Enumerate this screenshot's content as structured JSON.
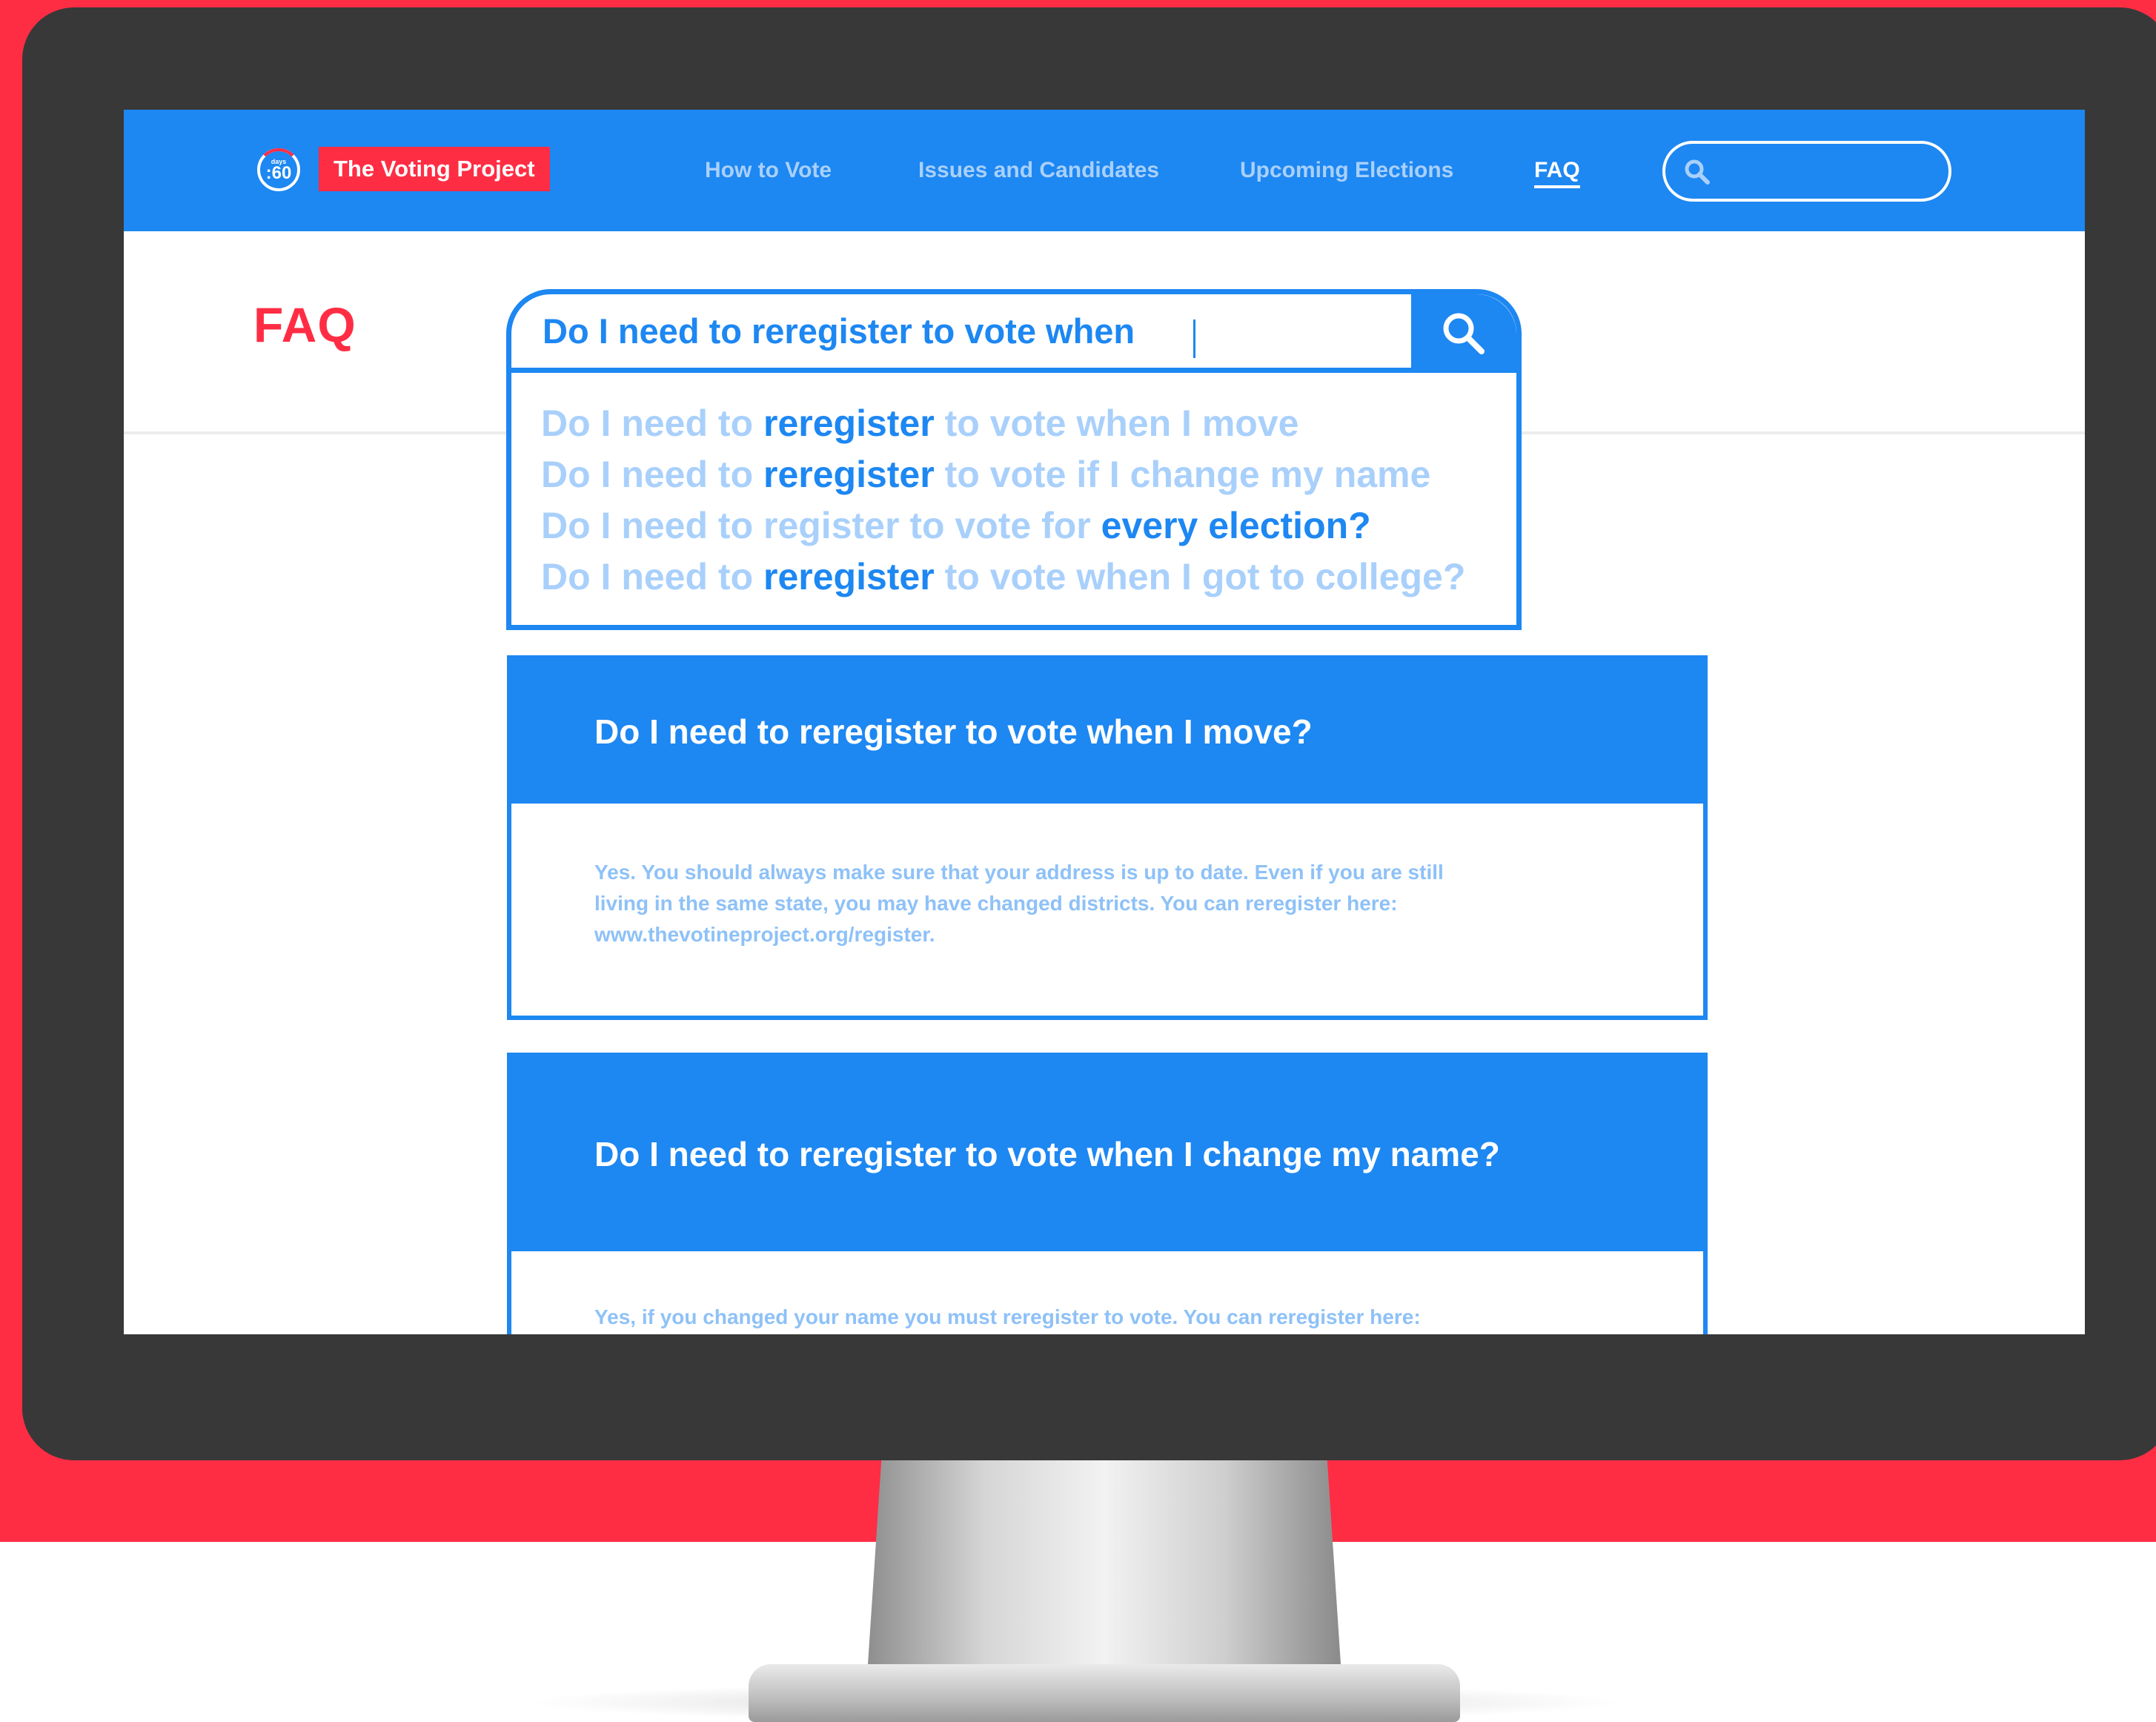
{
  "header": {
    "logo": {
      "small_text": "days",
      "big_text": ":60"
    },
    "brand": "The Voting Project",
    "nav": [
      {
        "label": "How to Vote"
      },
      {
        "label": "Issues and Candidates"
      },
      {
        "label": "Upcoming Elections"
      },
      {
        "label": "FAQ",
        "active": true
      }
    ],
    "search_placeholder": ""
  },
  "page": {
    "title": "FAQ"
  },
  "faq_search": {
    "query": "Do I need to reregister to vote when",
    "suggestions": [
      [
        {
          "t": "Do I need to ",
          "h": false
        },
        {
          "t": "reregister",
          "h": true
        },
        {
          "t": " to vote when I move",
          "h": false
        }
      ],
      [
        {
          "t": "Do I need to ",
          "h": false
        },
        {
          "t": "reregister",
          "h": true
        },
        {
          "t": " to vote if I change my name",
          "h": false
        }
      ],
      [
        {
          "t": "Do I need to register to vote for ",
          "h": false
        },
        {
          "t": "every election?",
          "h": true
        }
      ],
      [
        {
          "t": "Do I need to ",
          "h": false
        },
        {
          "t": "reregister",
          "h": true
        },
        {
          "t": " to vote when I got to college?",
          "h": false
        }
      ]
    ]
  },
  "faqs": [
    {
      "question": "Do I need to reregister to vote when I move?",
      "answer": "Yes. You should always make sure that your address is up to date. Even if you are still living in the same state, you may have changed districts. You can reregister here: www.thevotineproject.org/register."
    },
    {
      "question": "Do I need to reregister to vote when I change my name?",
      "answer": "Yes, if you changed your name you must reregister to vote. You can reregister here:"
    }
  ],
  "colors": {
    "brand_red": "#ff2d44",
    "primary_blue": "#1d87f2",
    "muted_blue": "#a9d0fb",
    "bezel": "#383838"
  }
}
